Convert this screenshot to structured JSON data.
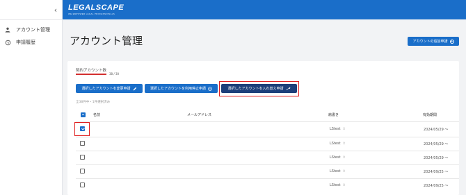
{
  "sidebar": {
    "collapse_icon": "chevron-left-icon",
    "items": [
      {
        "label": "アカウント管理",
        "icon": "person-icon"
      },
      {
        "label": "申請履歴",
        "icon": "history-icon"
      }
    ]
  },
  "header": {
    "logo_text": "LEGALSCAPE",
    "logo_tagline": "WE EMPOWER LEGAL PROFESSIONALS",
    "bg_color": "#1a6ec9"
  },
  "main": {
    "title": "アカウント管理",
    "add_button_label": "アカウントの追加申請",
    "contract_label": "契約アカウント数",
    "contract_count": "38 / 30",
    "contract_progress": 1.0,
    "actions": [
      {
        "label": "選択したアカウントを変更申請",
        "icon": "pencil-icon"
      },
      {
        "label": "選択したアカウントを利用停止申請",
        "icon": "minus-circle-icon"
      },
      {
        "label": "選択したアカウントを入れ替え申請",
        "icon": "swap-icon"
      }
    ],
    "selection_summary": "全38件中・1件選択済み"
  },
  "table": {
    "columns": [
      "名前",
      "メールアドレス",
      "肩書き",
      "有効期間"
    ],
    "rows": [
      {
        "checked": true,
        "title": "LStest",
        "period": "2024/05/29 〜"
      },
      {
        "checked": false,
        "title": "LStest",
        "period": "2024/05/29 〜"
      },
      {
        "checked": false,
        "title": "LStest",
        "period": "2024/05/29 〜"
      },
      {
        "checked": false,
        "title": "LStest",
        "period": "2024/09/25 〜"
      },
      {
        "checked": false,
        "title": "LStest",
        "period": "2024/09/25 〜"
      }
    ]
  },
  "colors": {
    "accent": "#1a6ec9",
    "accent_dark": "#1d3f7a",
    "highlight": "#e02020"
  }
}
